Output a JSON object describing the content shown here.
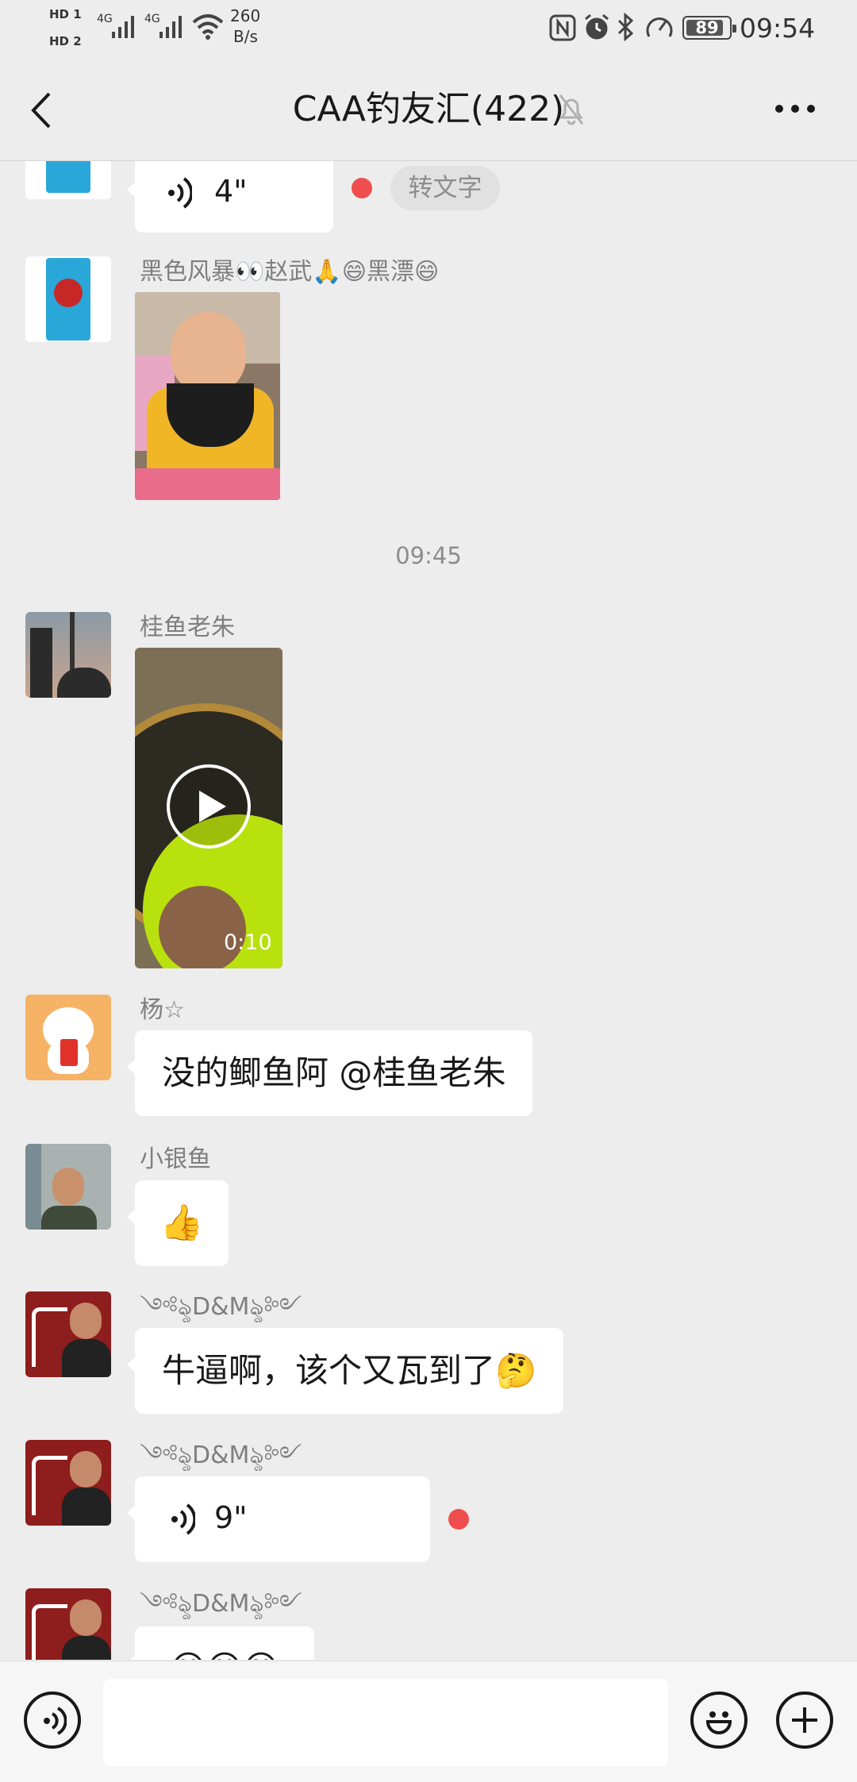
{
  "status_bar": {
    "hd1": "HD 1",
    "hd2": "HD 2",
    "net1": "4G",
    "net2": "4G",
    "speed_value": "260",
    "speed_unit": "B/s",
    "battery": "89",
    "battery_level": 0.89,
    "time": "09:54"
  },
  "nav": {
    "title": "CAA钓友汇(422)",
    "icons": [
      "back-arrow-icon",
      "mute-bell-icon",
      "more-icon"
    ]
  },
  "messages": [
    {
      "type": "voice",
      "duration": "4\"",
      "unread": true,
      "action": "转文字"
    },
    {
      "type": "image",
      "sender": "黑色风暴👀赵武🙏😄黑漂😄"
    },
    {
      "type": "time",
      "time": "09:45"
    },
    {
      "type": "video",
      "sender": "桂鱼老朱",
      "duration": "0:10"
    },
    {
      "type": "text",
      "sender": "杨☆",
      "text": "没的鲫鱼阿  @桂鱼老朱"
    },
    {
      "type": "emoji",
      "sender": "小银鱼",
      "text": "👍"
    },
    {
      "type": "text",
      "sender": "༺ৡD&Mৡ༻",
      "text": "牛逼啊，该个又瓦到了🤔"
    },
    {
      "type": "voice",
      "sender": "༺ৡD&Mৡ༻",
      "duration": "9\"",
      "unread": true
    },
    {
      "type": "emoji",
      "sender": "༺ৡD&Mৡ༻",
      "text": "😁😁😁"
    }
  ],
  "colors": {
    "background": "#ededed",
    "bubble": "#ffffff",
    "unread_dot": "#f04e4e",
    "sender_text": "#7f7f7f"
  },
  "bottom_bar": {
    "icons": [
      "voice-input-icon",
      "emoji-icon",
      "plus-icon"
    ]
  }
}
